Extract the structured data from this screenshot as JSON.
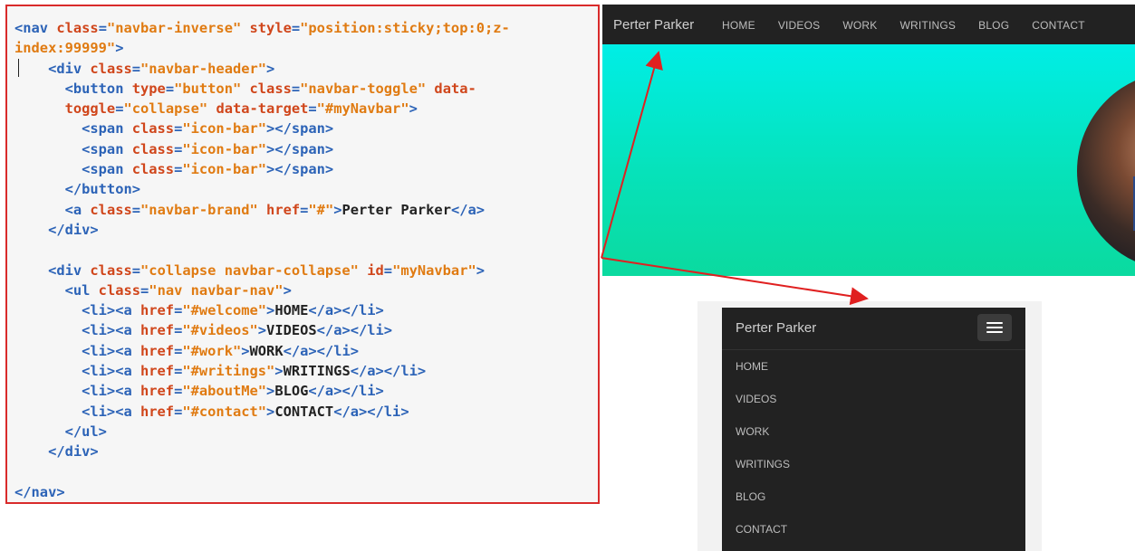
{
  "code": {
    "lines": [
      [
        [
          "tag",
          "<nav "
        ],
        [
          "attr",
          "class"
        ],
        [
          "tag",
          "="
        ],
        [
          "str",
          "\"navbar-inverse\""
        ],
        [
          "tag",
          " "
        ],
        [
          "attr",
          "style"
        ],
        [
          "tag",
          "="
        ],
        [
          "str",
          "\"position:sticky;top:0;z-"
        ]
      ],
      [
        [
          "str",
          "index:99999\""
        ],
        [
          "tag",
          ">"
        ]
      ],
      [
        [
          "tag",
          "    <div "
        ],
        [
          "attr",
          "class"
        ],
        [
          "tag",
          "="
        ],
        [
          "str",
          "\"navbar-header\""
        ],
        [
          "tag",
          ">"
        ]
      ],
      [
        [
          "tag",
          "      <button "
        ],
        [
          "attr",
          "type"
        ],
        [
          "tag",
          "="
        ],
        [
          "str",
          "\"button\""
        ],
        [
          "tag",
          " "
        ],
        [
          "attr",
          "class"
        ],
        [
          "tag",
          "="
        ],
        [
          "str",
          "\"navbar-toggle\""
        ],
        [
          "tag",
          " "
        ],
        [
          "attr",
          "data-"
        ]
      ],
      [
        [
          "attr",
          "      toggle"
        ],
        [
          "tag",
          "="
        ],
        [
          "str",
          "\"collapse\""
        ],
        [
          "tag",
          " "
        ],
        [
          "attr",
          "data-target"
        ],
        [
          "tag",
          "="
        ],
        [
          "str",
          "\"#myNavbar\""
        ],
        [
          "tag",
          ">"
        ]
      ],
      [
        [
          "tag",
          "        <span "
        ],
        [
          "attr",
          "class"
        ],
        [
          "tag",
          "="
        ],
        [
          "str",
          "\"icon-bar\""
        ],
        [
          "tag",
          "></span>"
        ]
      ],
      [
        [
          "tag",
          "        <span "
        ],
        [
          "attr",
          "class"
        ],
        [
          "tag",
          "="
        ],
        [
          "str",
          "\"icon-bar\""
        ],
        [
          "tag",
          "></span>"
        ]
      ],
      [
        [
          "tag",
          "        <span "
        ],
        [
          "attr",
          "class"
        ],
        [
          "tag",
          "="
        ],
        [
          "str",
          "\"icon-bar\""
        ],
        [
          "tag",
          "></span>"
        ]
      ],
      [
        [
          "tag",
          "      </button>"
        ]
      ],
      [
        [
          "tag",
          "      <a "
        ],
        [
          "attr",
          "class"
        ],
        [
          "tag",
          "="
        ],
        [
          "str",
          "\"navbar-brand\""
        ],
        [
          "tag",
          " "
        ],
        [
          "attr",
          "href"
        ],
        [
          "tag",
          "="
        ],
        [
          "str",
          "\"#\""
        ],
        [
          "tag",
          ">"
        ],
        [
          "txt",
          "Perter Parker"
        ],
        [
          "tag",
          "</a>"
        ]
      ],
      [
        [
          "tag",
          "    </div>"
        ]
      ],
      [
        [
          "txt",
          ""
        ]
      ],
      [
        [
          "tag",
          "    <div "
        ],
        [
          "attr",
          "class"
        ],
        [
          "tag",
          "="
        ],
        [
          "str",
          "\"collapse navbar-collapse\""
        ],
        [
          "tag",
          " "
        ],
        [
          "attr",
          "id"
        ],
        [
          "tag",
          "="
        ],
        [
          "str",
          "\"myNavbar\""
        ],
        [
          "tag",
          ">"
        ]
      ],
      [
        [
          "tag",
          "      <ul "
        ],
        [
          "attr",
          "class"
        ],
        [
          "tag",
          "="
        ],
        [
          "str",
          "\"nav navbar-nav\""
        ],
        [
          "tag",
          ">"
        ]
      ],
      [
        [
          "tag",
          "        <li><a "
        ],
        [
          "attr",
          "href"
        ],
        [
          "tag",
          "="
        ],
        [
          "str",
          "\"#welcome\""
        ],
        [
          "tag",
          ">"
        ],
        [
          "txt",
          "HOME"
        ],
        [
          "tag",
          "</a></li>"
        ]
      ],
      [
        [
          "tag",
          "        <li><a "
        ],
        [
          "attr",
          "href"
        ],
        [
          "tag",
          "="
        ],
        [
          "str",
          "\"#videos\""
        ],
        [
          "tag",
          ">"
        ],
        [
          "txt",
          "VIDEOS"
        ],
        [
          "tag",
          "</a></li>"
        ]
      ],
      [
        [
          "tag",
          "        <li><a "
        ],
        [
          "attr",
          "href"
        ],
        [
          "tag",
          "="
        ],
        [
          "str",
          "\"#work\""
        ],
        [
          "tag",
          ">"
        ],
        [
          "txt",
          "WORK"
        ],
        [
          "tag",
          "</a></li>"
        ]
      ],
      [
        [
          "tag",
          "        <li><a "
        ],
        [
          "attr",
          "href"
        ],
        [
          "tag",
          "="
        ],
        [
          "str",
          "\"#writings\""
        ],
        [
          "tag",
          ">"
        ],
        [
          "txt",
          "WRITINGS"
        ],
        [
          "tag",
          "</a></li>"
        ]
      ],
      [
        [
          "tag",
          "        <li><a "
        ],
        [
          "attr",
          "href"
        ],
        [
          "tag",
          "="
        ],
        [
          "str",
          "\"#aboutMe\""
        ],
        [
          "tag",
          ">"
        ],
        [
          "txt",
          "BLOG"
        ],
        [
          "tag",
          "</a></li>"
        ]
      ],
      [
        [
          "tag",
          "        <li><a "
        ],
        [
          "attr",
          "href"
        ],
        [
          "tag",
          "="
        ],
        [
          "str",
          "\"#contact\""
        ],
        [
          "tag",
          ">"
        ],
        [
          "txt",
          "CONTACT"
        ],
        [
          "tag",
          "</a></li>"
        ]
      ],
      [
        [
          "tag",
          "      </ul>"
        ]
      ],
      [
        [
          "tag",
          "    </div>"
        ]
      ],
      [
        [
          "txt",
          ""
        ]
      ],
      [
        [
          "tag",
          "</nav>"
        ]
      ]
    ]
  },
  "desktop": {
    "brand": "Perter Parker",
    "nav_items": [
      "HOME",
      "VIDEOS",
      "WORK",
      "WRITINGS",
      "BLOG",
      "CONTACT"
    ]
  },
  "mobile": {
    "brand": "Perter Parker",
    "toggle_icon": "hamburger-icon",
    "nav_items": [
      "HOME",
      "VIDEOS",
      "WORK",
      "WRITINGS",
      "BLOG",
      "CONTACT"
    ]
  },
  "colors": {
    "highlight_border": "#d92b2b",
    "arrow": "#e02020",
    "navbar": "#222222",
    "hero_top": "#00eee6",
    "hero_bottom": "#0bda9f",
    "code_tag": "#2c63b7",
    "code_attr": "#d0461b",
    "code_string": "#e07b12"
  }
}
